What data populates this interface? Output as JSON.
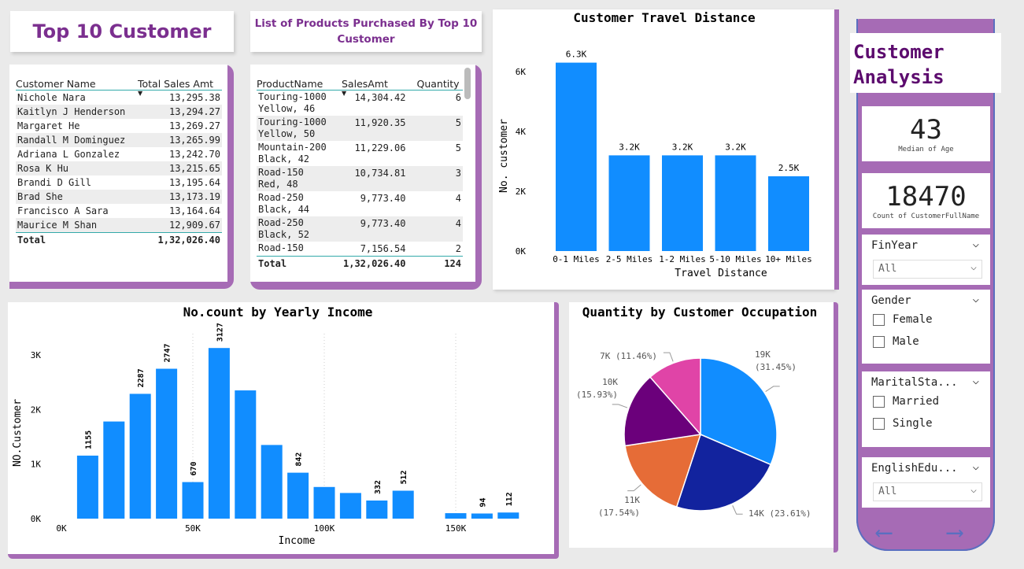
{
  "titles": {
    "top_customers": "Top 10 Customer",
    "products_line1": "List of Products Purchased By Top 10",
    "products_line2": "Customer"
  },
  "customer_table": {
    "headers": [
      "Customer Name",
      "Total Sales Amt"
    ],
    "rows": [
      [
        "Nichole Nara",
        "13,295.38"
      ],
      [
        "Kaitlyn J Henderson",
        "13,294.27"
      ],
      [
        "Margaret He",
        "13,269.27"
      ],
      [
        "Randall M Dominguez",
        "13,265.99"
      ],
      [
        "Adriana L Gonzalez",
        "13,242.70"
      ],
      [
        "Rosa K Hu",
        "13,215.65"
      ],
      [
        "Brandi D Gill",
        "13,195.64"
      ],
      [
        "Brad She",
        "13,173.19"
      ],
      [
        "Francisco A Sara",
        "13,164.64"
      ],
      [
        "Maurice M Shan",
        "12,909.67"
      ]
    ],
    "total_label": "Total",
    "total_value": "1,32,026.40"
  },
  "product_table": {
    "headers": [
      "ProductName",
      "SalesAmt",
      "Quantity"
    ],
    "rows": [
      [
        "Touring-1000",
        "Yellow, 46",
        "14,304.42",
        "6"
      ],
      [
        "Touring-1000",
        "Yellow, 50",
        "11,920.35",
        "5"
      ],
      [
        "Mountain-200",
        "Black, 42",
        "11,229.06",
        "5"
      ],
      [
        "Road-150",
        "Red, 48",
        "10,734.81",
        "3"
      ],
      [
        "Road-250",
        "Black, 44",
        "9,773.40",
        "4"
      ],
      [
        "Road-250",
        "Black, 52",
        "9,773.40",
        "4"
      ],
      [
        "Road-150",
        "",
        "7,156.54",
        "2"
      ]
    ],
    "total_label": "Total",
    "total_sales": "1,32,026.40",
    "total_qty": "124"
  },
  "chart_data": [
    {
      "type": "bar",
      "title": "Customer Travel Distance",
      "xlabel": "Travel Distance",
      "ylabel": "No. customer",
      "categories": [
        "0-1 Miles",
        "2-5 Miles",
        "1-2 Miles",
        "5-10 Miles",
        "10+ Miles"
      ],
      "values": [
        6300,
        3200,
        3200,
        3200,
        2500
      ],
      "data_labels": [
        "6.3K",
        "3.2K",
        "3.2K",
        "3.2K",
        "2.5K"
      ],
      "yticks": [
        "0K",
        "2K",
        "4K",
        "6K"
      ],
      "ylim": [
        0,
        6500
      ],
      "color": "#118dff"
    },
    {
      "type": "bar",
      "title": "No.count by Yearly Income",
      "xlabel": "Income",
      "ylabel": "NO.Customer",
      "x": [
        10000,
        20000,
        30000,
        40000,
        50000,
        60000,
        70000,
        80000,
        90000,
        100000,
        110000,
        120000,
        130000,
        150000,
        160000,
        170000
      ],
      "values": [
        1155,
        1780,
        2287,
        2747,
        670,
        3127,
        2350,
        1350,
        842,
        580,
        470,
        332,
        512,
        100,
        94,
        112
      ],
      "data_labels": [
        "1155",
        "",
        "2287",
        "2747",
        "670",
        "3127",
        "",
        "",
        "842",
        "",
        "",
        "332",
        "512",
        "",
        "94",
        "112"
      ],
      "yticks": [
        "0K",
        "1K",
        "2K",
        "3K"
      ],
      "xticks": [
        "0K",
        "50K",
        "100K",
        "150K"
      ],
      "ylim": [
        0,
        3300
      ],
      "xlim": [
        0,
        180000
      ],
      "color": "#118dff"
    },
    {
      "type": "pie",
      "title": "Quantity by Customer Occupation",
      "slices": [
        {
          "value": 31.45,
          "label1": "19K",
          "label2": "(31.45%)",
          "color": "#118dff"
        },
        {
          "value": 23.61,
          "label1": "14K (23.61%)",
          "label2": "",
          "color": "#12239e"
        },
        {
          "value": 17.54,
          "label1": "11K",
          "label2": "(17.54%)",
          "color": "#e66c37"
        },
        {
          "value": 15.93,
          "label1": "10K",
          "label2": "(15.93%)",
          "color": "#6b007b"
        },
        {
          "value": 11.46,
          "label1": "7K (11.46%)",
          "label2": "",
          "color": "#e044a7"
        }
      ]
    }
  ],
  "panel": {
    "title_line1": "Customer",
    "title_line2": "Analysis",
    "kpi1_value": "43",
    "kpi1_label": "Median of Age",
    "kpi2_value": "18470",
    "kpi2_label": "Count of CustomerFullName",
    "finyear_label": "FinYear",
    "finyear_value": "All",
    "gender_label": "Gender",
    "gender_opt1": "Female",
    "gender_opt2": "Male",
    "marital_label": "MaritalSta...",
    "marital_opt1": "Married",
    "marital_opt2": "Single",
    "edu_label": "EnglishEdu...",
    "edu_value": "All"
  },
  "colors": {
    "accent": "#a66bb5",
    "title_purple": "#7b2f8f",
    "panel_title": "#5c0b6e"
  }
}
